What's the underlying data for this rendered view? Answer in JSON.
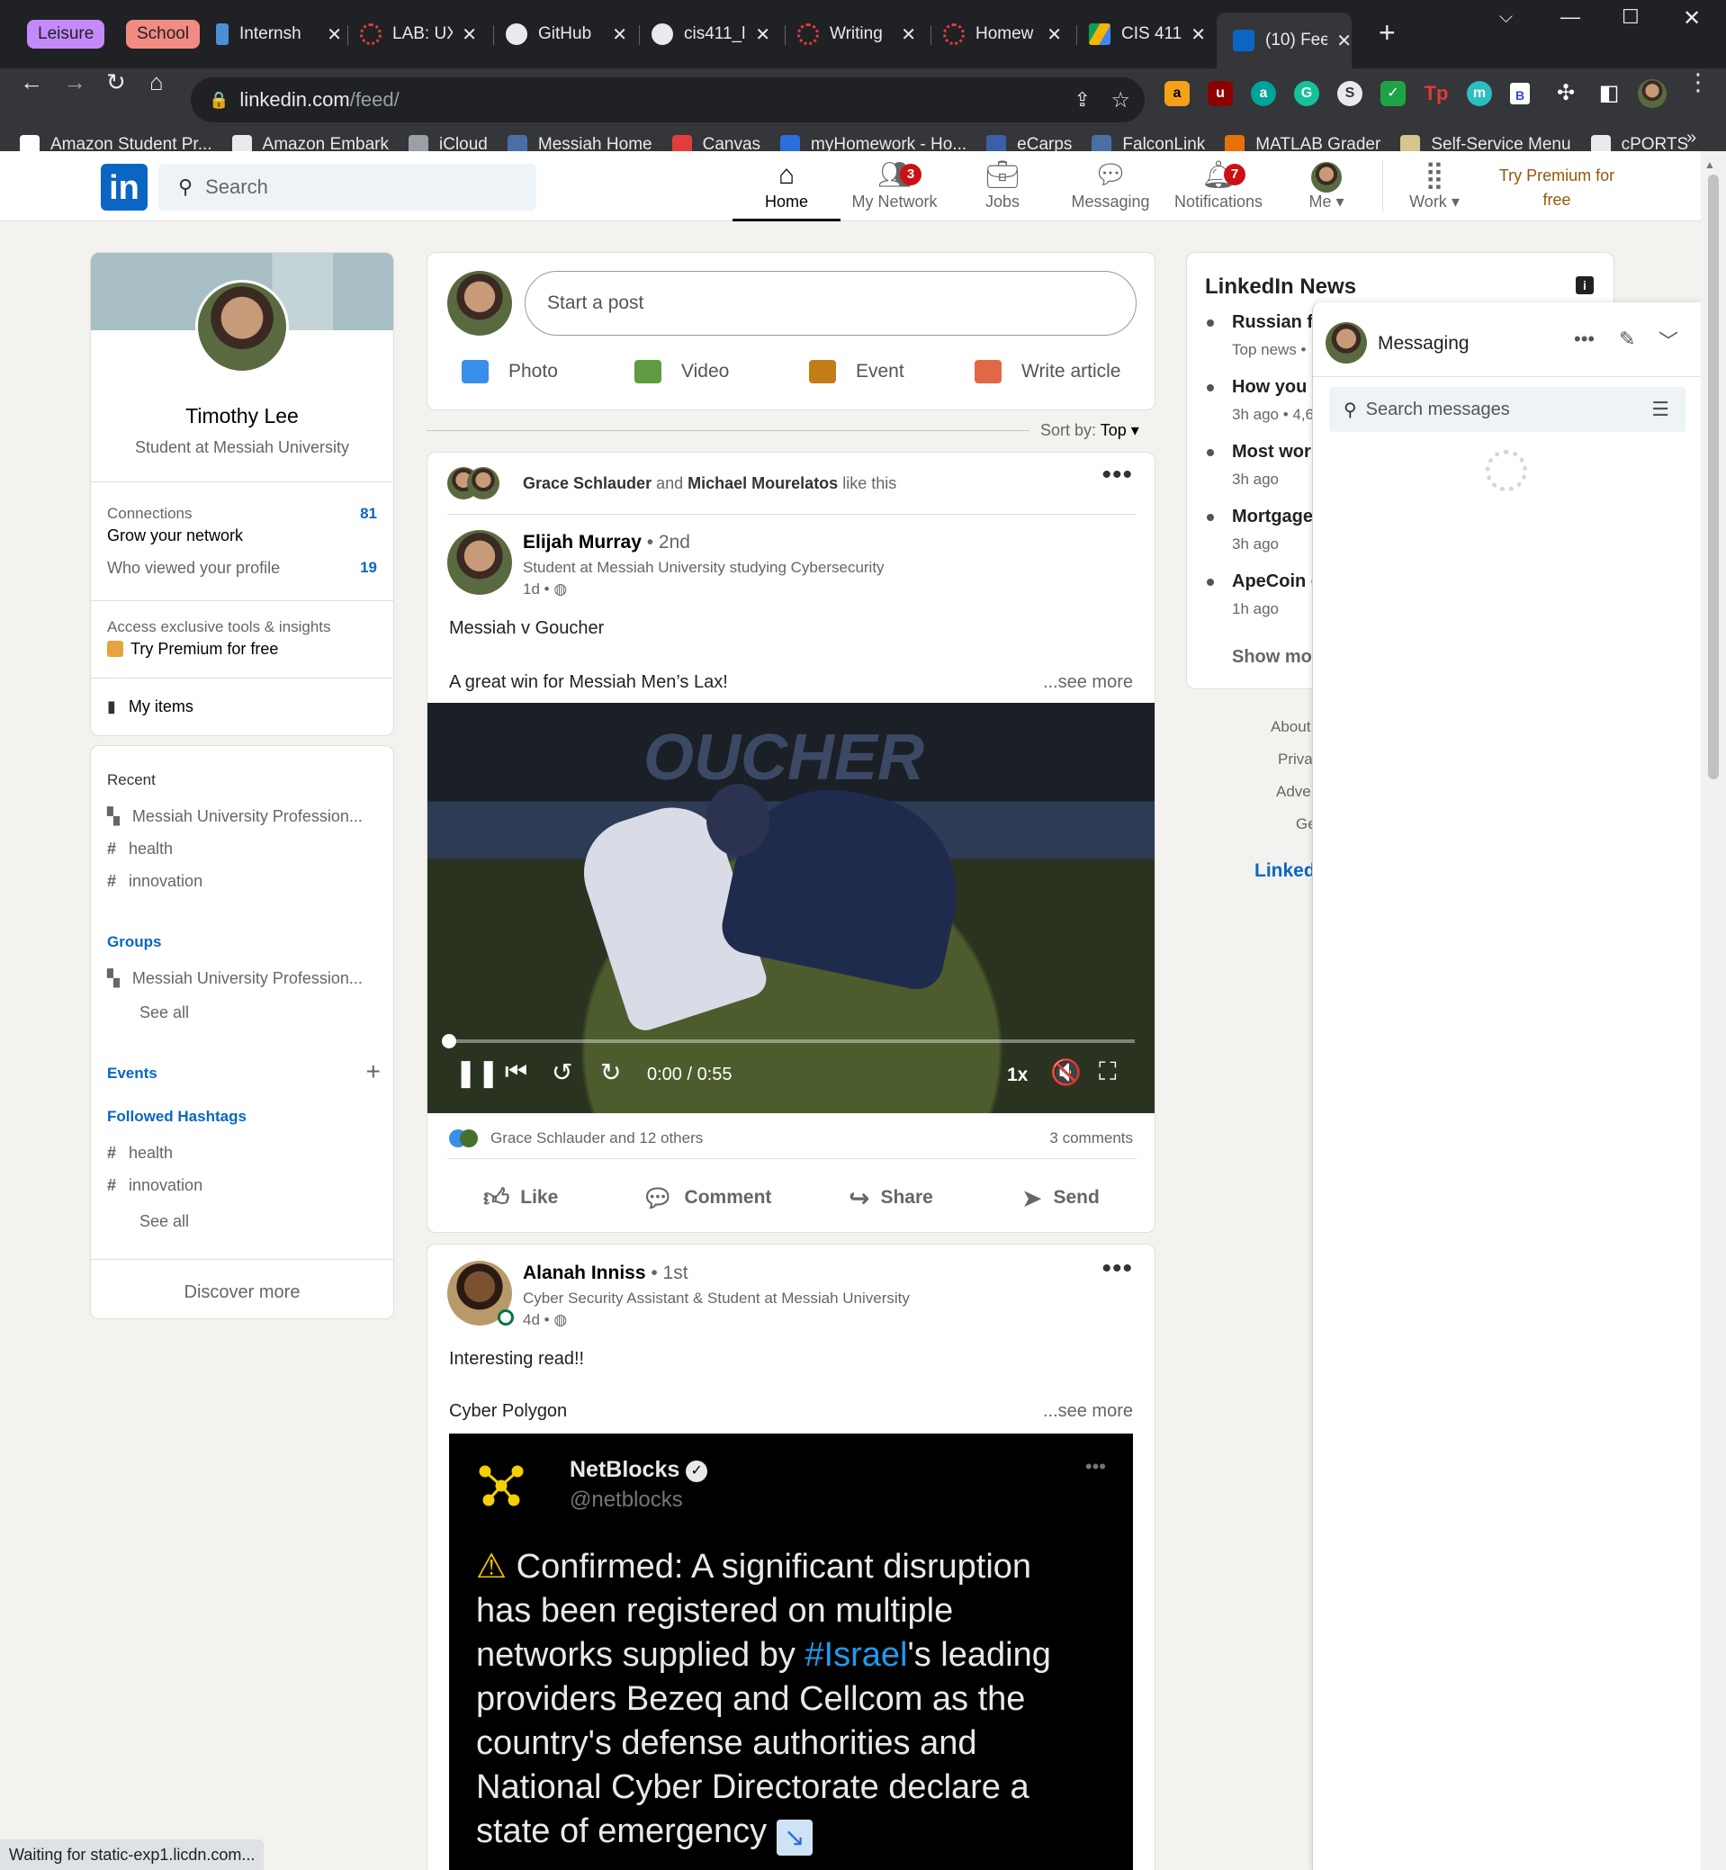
{
  "browser": {
    "groups": [
      {
        "label": "Leisure",
        "color": "#c58af9"
      },
      {
        "label": "School",
        "color": "#f28b82"
      }
    ],
    "tabs": [
      {
        "label": "Internsh",
        "icon": "person-icon",
        "color": "#4a90d9"
      },
      {
        "label": "LAB: UX",
        "icon": "canvas-icon",
        "color": "#e23d3d"
      },
      {
        "label": "GitHub",
        "icon": "github-icon",
        "color": "#e8eaed"
      },
      {
        "label": "cis411_l",
        "icon": "github-icon",
        "color": "#e8eaed"
      },
      {
        "label": "Writing",
        "icon": "canvas-icon",
        "color": "#e23d3d"
      },
      {
        "label": "Homew",
        "icon": "canvas-icon",
        "color": "#e23d3d"
      },
      {
        "label": "CIS 411",
        "icon": "drive-icon",
        "color": "#f4b400"
      },
      {
        "label": "(10) Fee",
        "icon": "linkedin-icon",
        "color": "#0a66c2"
      }
    ],
    "url_domain": "linkedin.com",
    "url_path": "/feed/",
    "bookmarks": [
      {
        "label": "Amazon Student Pr...",
        "color": "#ffffff"
      },
      {
        "label": "Amazon Embark",
        "color": "#e8eaed"
      },
      {
        "label": "iCloud",
        "color": "#9aa0a6"
      },
      {
        "label": "Messiah Home",
        "color": "#4a6fa5"
      },
      {
        "label": "Canvas",
        "color": "#e23d3d"
      },
      {
        "label": "myHomework - Ho...",
        "color": "#2a6fdb"
      },
      {
        "label": "eCarps",
        "color": "#3b5fa8"
      },
      {
        "label": "FalconLink",
        "color": "#4a6fa5"
      },
      {
        "label": "MATLAB Grader",
        "color": "#e8710a"
      },
      {
        "label": "Self-Service Menu",
        "color": "#d7c58b"
      },
      {
        "label": "cPORTS",
        "color": "#e8eaed"
      }
    ],
    "status_text": "Waiting for static-exp1.licdn.com..."
  },
  "header": {
    "search_placeholder": "Search",
    "nav": [
      {
        "label": "Home",
        "icon": "home-icon",
        "badge": ""
      },
      {
        "label": "My Network",
        "icon": "network-icon",
        "badge": "3"
      },
      {
        "label": "Jobs",
        "icon": "briefcase-icon",
        "badge": ""
      },
      {
        "label": "Messaging",
        "icon": "chat-icon",
        "badge": ""
      },
      {
        "label": "Notifications",
        "icon": "bell-icon",
        "badge": "7"
      },
      {
        "label": "Me",
        "icon": "avatar",
        "badge": ""
      }
    ],
    "work_label": "Work",
    "premium_line1": "Try Premium for",
    "premium_line2": "free"
  },
  "profile": {
    "name": "Timothy Lee",
    "headline": "Student at Messiah University",
    "connections_label": "Connections",
    "connections_count": "81",
    "grow_label": "Grow your network",
    "viewed_label": "Who viewed your profile",
    "viewed_count": "19",
    "premium_hint": "Access exclusive tools & insights",
    "premium_cta": "Try Premium for free",
    "my_items": "My items"
  },
  "sidebar": {
    "recent_title": "Recent",
    "recent": [
      "Messiah University Profession...",
      "health",
      "innovation"
    ],
    "groups_title": "Groups",
    "groups": [
      "Messiah University Profession..."
    ],
    "see_all": "See all",
    "events_title": "Events",
    "hashtags_title": "Followed Hashtags",
    "hashtags": [
      "health",
      "innovation"
    ],
    "discover_more": "Discover more"
  },
  "composer": {
    "placeholder": "Start a post",
    "actions": [
      {
        "label": "Photo",
        "color": "#378fe9"
      },
      {
        "label": "Video",
        "color": "#5f9b41"
      },
      {
        "label": "Event",
        "color": "#c37d16"
      },
      {
        "label": "Write article",
        "color": "#e06847"
      }
    ],
    "sort_label": "Sort by:",
    "sort_value": "Top"
  },
  "post1": {
    "liker1": "Grace Schlauder",
    "and": "and",
    "liker2": "Michael Mourelatos",
    "like_suffix": "like this",
    "author": "Elijah Murray",
    "degree": "• 2nd",
    "headline": "Student at Messiah University studying Cybersecurity",
    "age": "1d •",
    "text1": "Messiah v Goucher",
    "text2": "A great win for Messiah Men’s Lax!",
    "see_more": "...see more",
    "video_time": "0:00 / 0:55",
    "video_speed": "1x",
    "progress": 0,
    "reactions": "Grace Schlauder and 12 others",
    "comments": "3 comments",
    "actions": [
      "Like",
      "Comment",
      "Share",
      "Send"
    ]
  },
  "post2": {
    "author": "Alanah Inniss",
    "degree": "• 1st",
    "headline": "Cyber Security Assistant & Student at Messiah University",
    "age": "4d •",
    "text1": "Interesting read!!",
    "text2": "Cyber Polygon",
    "see_more": "...see more",
    "tweet_name": "NetBlocks",
    "tweet_handle": "@netblocks",
    "tweet_line1": "Confirmed: A significant disruption",
    "tweet_line2": "has been registered on multiple",
    "tweet_line3_pre": "networks supplied by ",
    "tweet_hashtag": "#Israel",
    "tweet_line3_post": "'s leading",
    "tweet_line4": "providers Bezeq and Cellcom as the",
    "tweet_line5": "country's defense authorities and",
    "tweet_line6": "National Cyber Directorate declare a",
    "tweet_line7": "state of emergency"
  },
  "news": {
    "title": "LinkedIn News",
    "items": [
      {
        "headline": "Russian fo",
        "meta": "Top news •"
      },
      {
        "headline": "How you",
        "meta": "3h ago • 4,6"
      },
      {
        "headline": "Most wor",
        "meta": "3h ago"
      },
      {
        "headline": "Mortgage",
        "meta": "3h ago"
      },
      {
        "headline": "ApeCoin c",
        "meta": "1h ago"
      }
    ],
    "show_more": "Show mo",
    "footer": [
      "About",
      "Priva",
      "Adve",
      "Ge"
    ],
    "brand": "Linked"
  },
  "messaging": {
    "title": "Messaging",
    "search_placeholder": "Search messages"
  }
}
